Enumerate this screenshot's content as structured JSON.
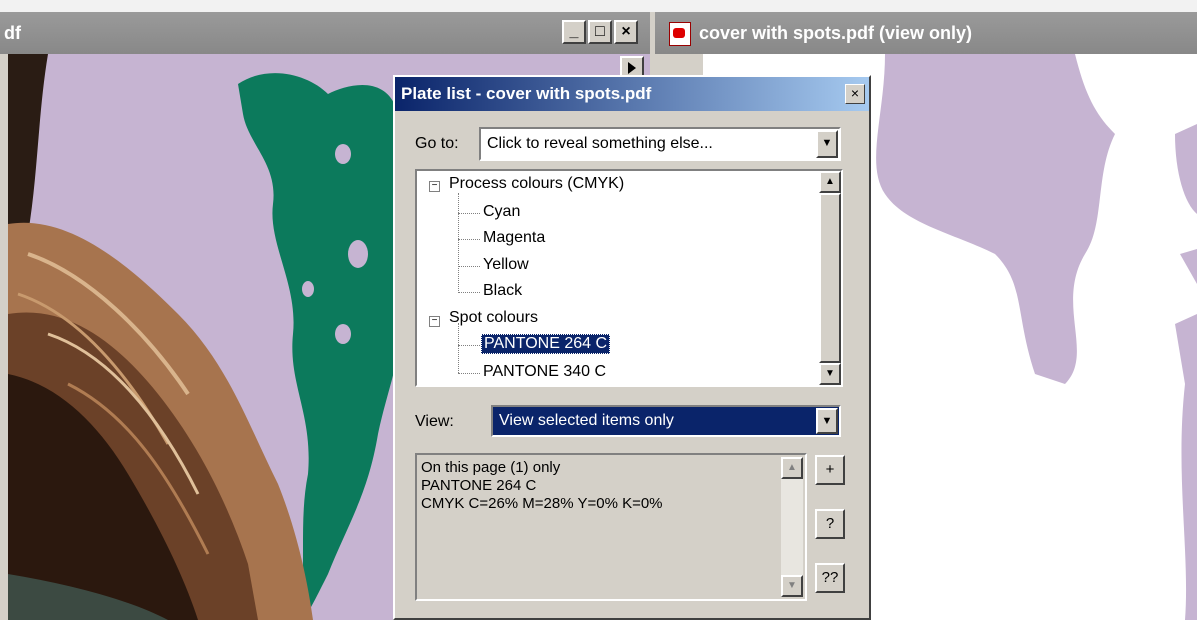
{
  "left_window": {
    "title": "df",
    "controls": [
      "_",
      "□",
      "×"
    ]
  },
  "right_window": {
    "title": "cover with spots.pdf (view only)"
  },
  "dialog": {
    "title": "Plate list - cover with spots.pdf",
    "close_label": "×",
    "goto_label": "Go to:",
    "goto_value": "Click to reveal something else...",
    "tree": {
      "groups": [
        {
          "label": "Process colours (CMYK)",
          "items": [
            "Cyan",
            "Magenta",
            "Yellow",
            "Black"
          ]
        },
        {
          "label": "Spot colours",
          "items": [
            "PANTONE 264 C",
            "PANTONE 340 C"
          ]
        }
      ],
      "selected": "PANTONE 264 C"
    },
    "view_label": "View:",
    "view_value": "View selected items only",
    "info_lines": [
      "On this page (1) only",
      "PANTONE 264 C",
      "CMYK C=26% M=28% Y=0% K=0%"
    ],
    "side_buttons": [
      "+",
      "?",
      "??"
    ]
  },
  "colors": {
    "lilac": "#c6b4d2",
    "green": "#0c7a5c",
    "selection": "#0a246a"
  }
}
